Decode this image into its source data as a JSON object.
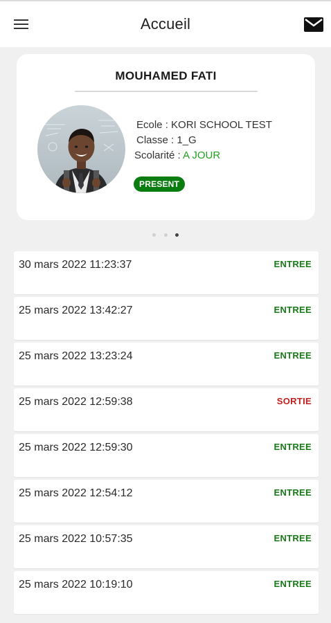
{
  "header": {
    "title": "Accueil",
    "menu_icon": "hamburger-menu-icon",
    "mail_icon": "envelope-icon"
  },
  "student": {
    "name": "MOUHAMED FATI",
    "school_line": "Ecole : KORI SCHOOL TEST",
    "class_line": "Classe : 1_G",
    "scolarite_label": "Scolarité : ",
    "scolarite_value": "A JOUR",
    "status_badge": "PRESENT"
  },
  "pager": {
    "count": 3,
    "active_index": 2
  },
  "logs": [
    {
      "time": "30 mars 2022 11:23:37",
      "type": "ENTREE"
    },
    {
      "time": "25 mars 2022 13:42:27",
      "type": "ENTREE"
    },
    {
      "time": "25 mars 2022 13:23:24",
      "type": "ENTREE"
    },
    {
      "time": "25 mars 2022 12:59:38",
      "type": "SORTIE"
    },
    {
      "time": "25 mars 2022 12:59:30",
      "type": "ENTREE"
    },
    {
      "time": "25 mars 2022 12:54:12",
      "type": "ENTREE"
    },
    {
      "time": "25 mars 2022 10:57:35",
      "type": "ENTREE"
    },
    {
      "time": "25 mars 2022 10:19:10",
      "type": "ENTREE"
    }
  ],
  "colors": {
    "entree": "#177a17",
    "sortie": "#c01f1f",
    "present_badge": "#0a7d10",
    "scolarite_ok": "#22a022"
  }
}
